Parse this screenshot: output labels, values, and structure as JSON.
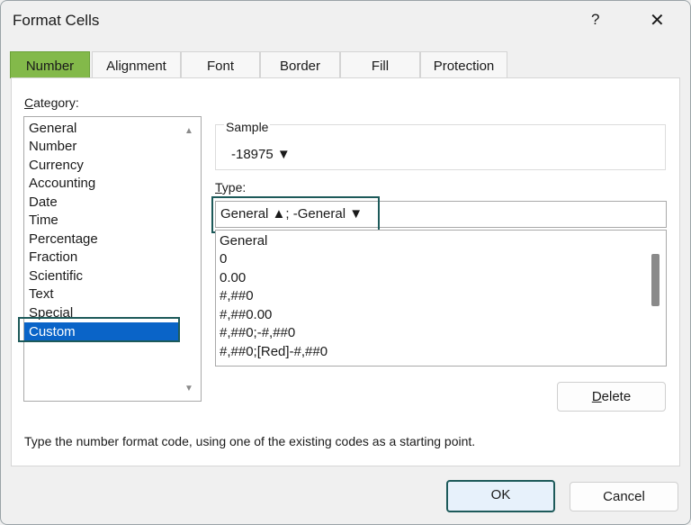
{
  "window": {
    "title": "Format Cells",
    "help": "?",
    "close": "✕"
  },
  "tabs": [
    "Number",
    "Alignment",
    "Font",
    "Border",
    "Fill",
    "Protection"
  ],
  "category": {
    "label": "Category:",
    "items": [
      "General",
      "Number",
      "Currency",
      "Accounting",
      "Date",
      "Time",
      "Percentage",
      "Fraction",
      "Scientific",
      "Text",
      "Special",
      "Custom"
    ],
    "selected": "Custom"
  },
  "sample": {
    "label": "Sample",
    "value": "-18975 ▼"
  },
  "type": {
    "label": "Type:",
    "value": "General ▲; -General ▼",
    "list": [
      "General",
      "0",
      "0.00",
      "#,##0",
      "#,##0.00",
      "#,##0;-#,##0",
      "#,##0;[Red]-#,##0"
    ]
  },
  "buttons": {
    "delete": "Delete",
    "ok": "OK",
    "cancel": "Cancel"
  },
  "hint": "Type the number format code, using one of the existing codes as a starting point.",
  "colors": {
    "active_tab": "#83b94a",
    "selection": "#0a64c8",
    "highlight_outline": "#1d5a5a"
  }
}
